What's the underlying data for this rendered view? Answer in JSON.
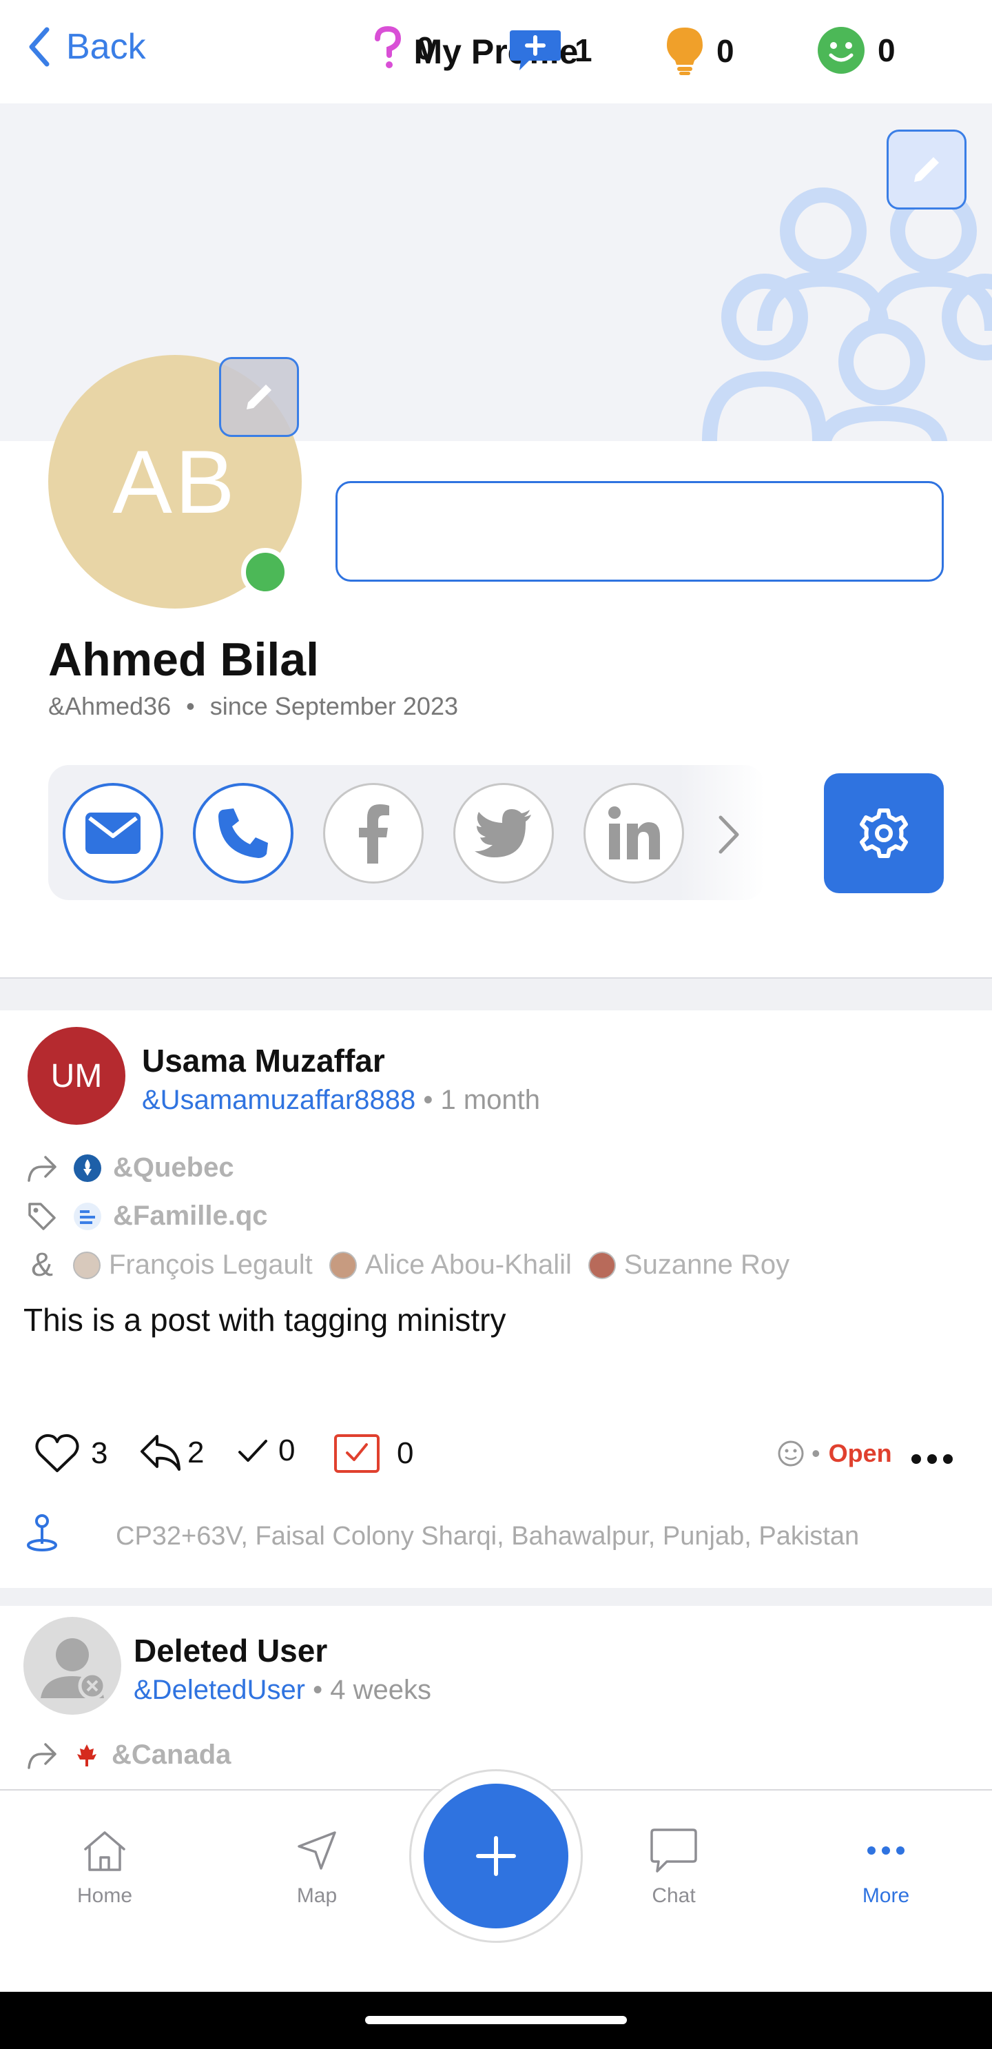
{
  "nav": {
    "back_label": "Back",
    "title": "My Profile"
  },
  "profile": {
    "initials": "AB",
    "name": "Ahmed Bilal",
    "handle": "&Ahmed36",
    "since": "since September 2023",
    "online": true
  },
  "stats": [
    {
      "icon": "question-icon",
      "count": "0",
      "color": "#d94fd6"
    },
    {
      "icon": "comment-plus-icon",
      "count": "1",
      "color": "#2f73e0"
    },
    {
      "icon": "lightbulb-icon",
      "count": "0",
      "color": "#f0a02a"
    },
    {
      "icon": "smiley-icon",
      "count": "0",
      "color": "#4cb857"
    }
  ],
  "social": [
    "email-icon",
    "phone-icon",
    "facebook-icon",
    "twitter-icon",
    "linkedin-icon"
  ],
  "post": {
    "author_initials": "UM",
    "author": "Usama Muzaffar",
    "handle": "&Usamamuzaffar8888",
    "time": "• 1 month",
    "share_tag": "&Quebec",
    "category_tag": "&Famille.qc",
    "people": [
      "François Legault",
      "Alice Abou-Khalil",
      "Suzanne Roy"
    ],
    "body": "This is a post with tagging ministry",
    "likes": "3",
    "replies": "2",
    "checks": "0",
    "tasks": "0",
    "status": "Open",
    "location": "CP32+63V, Faisal Colony Sharqi, Bahawalpur, Punjab, Pakistan"
  },
  "post2": {
    "author": "Deleted User",
    "handle": "&DeletedUser",
    "time": "• 4 weeks",
    "share_tag": "&Canada"
  },
  "tabs": {
    "home": "Home",
    "map": "Map",
    "chat": "Chat",
    "more": "More"
  },
  "colors": {
    "accent": "#2f73e0",
    "open": "#e0402e"
  }
}
